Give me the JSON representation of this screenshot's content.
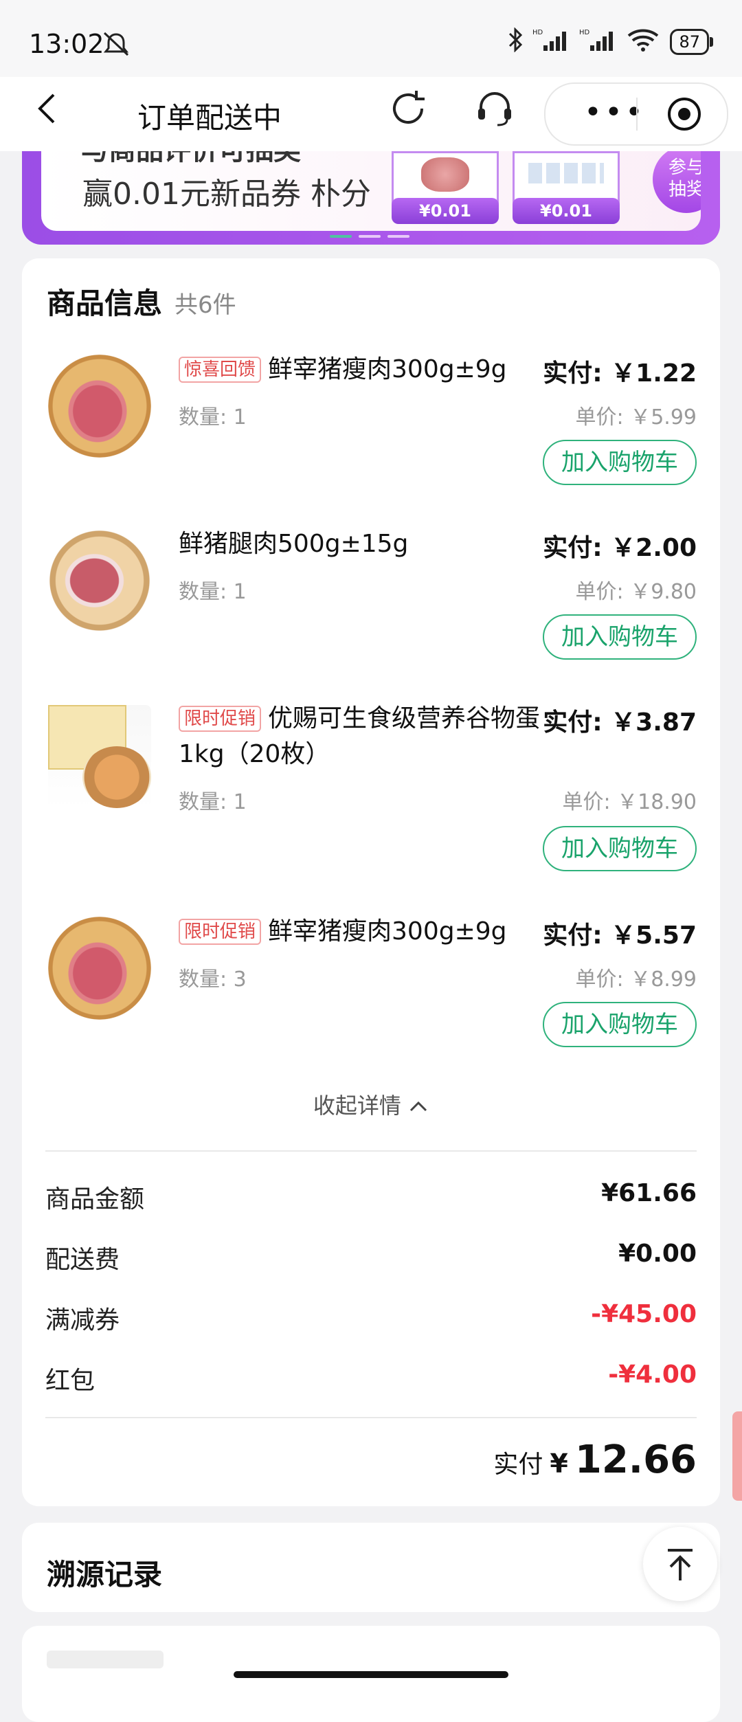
{
  "status": {
    "time": "13:02",
    "battery": "87"
  },
  "nav": {
    "title": "订单配送中"
  },
  "banner": {
    "headline": "与商品评价可抽奖",
    "subtitle": "赢0.01元新品券 朴分",
    "price1": "¥0.01",
    "price2": "¥0.01",
    "join": "参与抽奖"
  },
  "goods": {
    "title": "商品信息",
    "count": "共6件",
    "items": [
      {
        "tag": "惊喜回馈",
        "name": "鲜宰猪瘦肉300g±9g",
        "qty": "数量: 1",
        "paid": "实付: ￥1.22",
        "unit": "单价: ￥5.99",
        "button": "加入购物车"
      },
      {
        "tag": "",
        "name": "鲜猪腿肉500g±15g",
        "qty": "数量: 1",
        "paid": "实付: ￥2.00",
        "unit": "单价: ￥9.80",
        "button": "加入购物车"
      },
      {
        "tag": "限时促销",
        "name": "优赐可生食级营养谷物蛋1kg（20枚）",
        "qty": "数量: 1",
        "paid": "实付: ￥3.87",
        "unit": "单价: ￥18.90",
        "button": "加入购物车"
      },
      {
        "tag": "限时促销",
        "name": "鲜宰猪瘦肉300g±9g",
        "qty": "数量: 3",
        "paid": "实付: ￥5.57",
        "unit": "单价: ￥8.99",
        "button": "加入购物车"
      }
    ],
    "collapse": "收起详情"
  },
  "summary": {
    "rows": [
      {
        "label": "商品金额",
        "value": "¥61.66"
      },
      {
        "label": "配送费",
        "value": "¥0.00"
      },
      {
        "label": "满减券",
        "value": "-¥45.00"
      },
      {
        "label": "红包",
        "value": "-¥4.00"
      }
    ],
    "total_label": "实付",
    "total_currency": "¥",
    "total_amount": "12.66"
  },
  "trace": {
    "title": "溯源记录"
  },
  "colors": {
    "accent_green": "#1aa36b",
    "discount_red": "#ef2f3d",
    "banner_purple": "#9b4ee6"
  }
}
